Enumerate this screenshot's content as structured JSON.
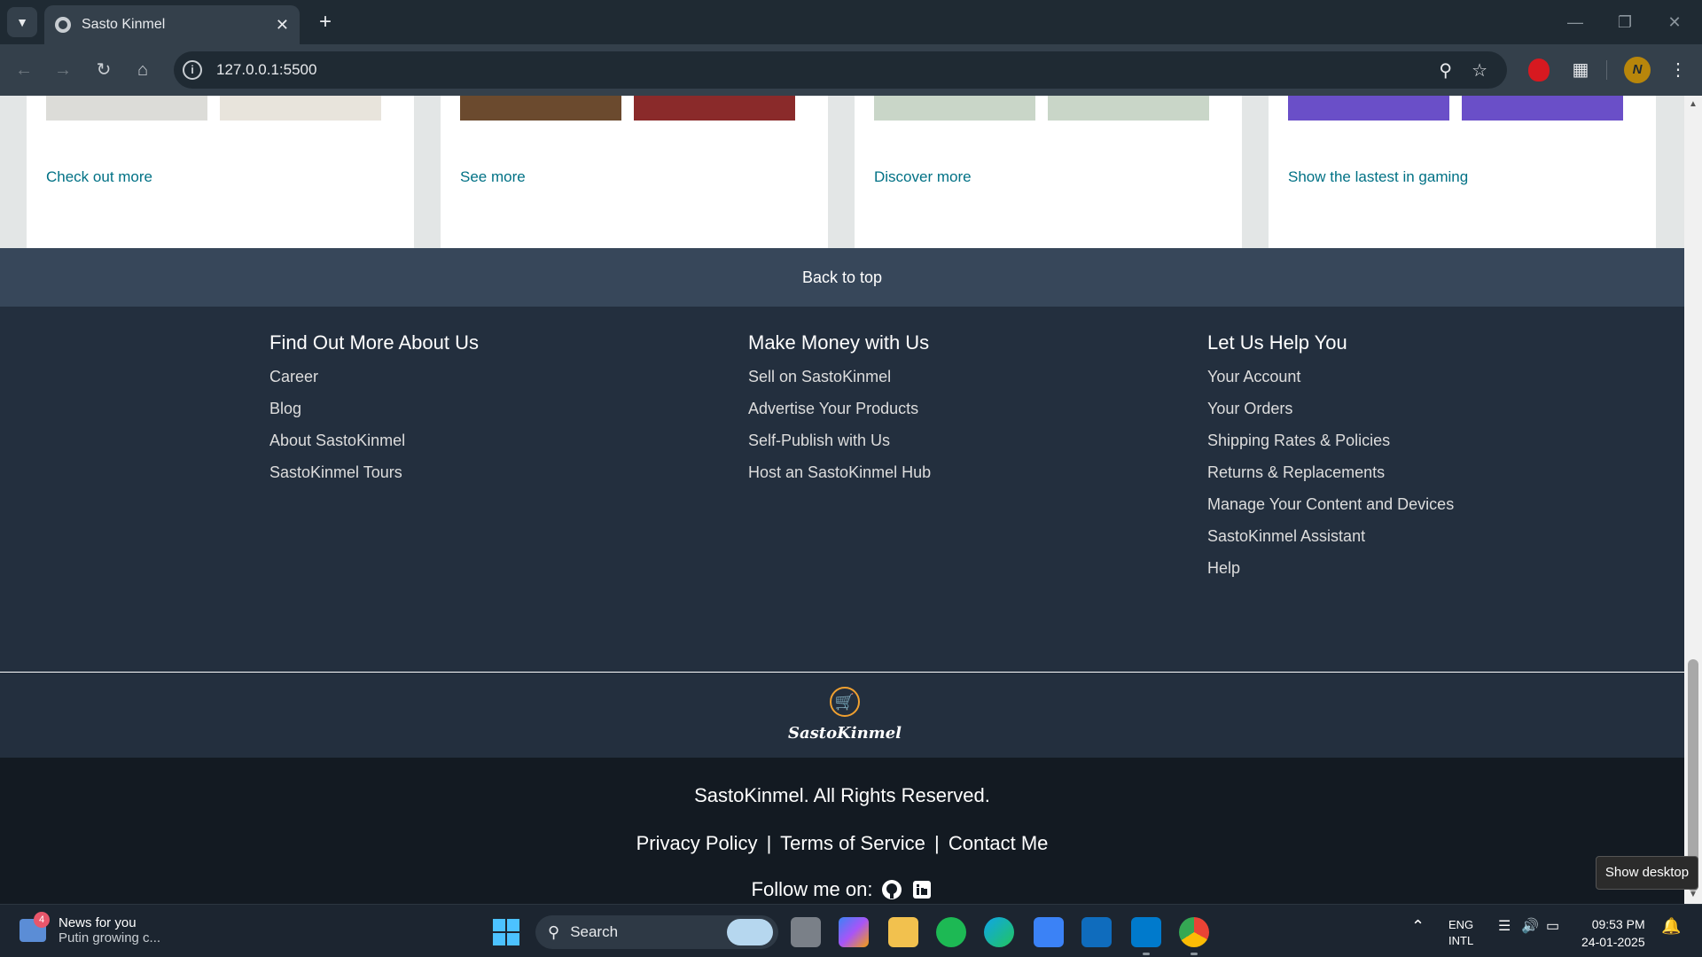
{
  "browser": {
    "tab_title": "Sasto Kinmel",
    "url": "127.0.0.1:5500",
    "profile_initial": "N"
  },
  "cards": [
    {
      "link": "Check out more",
      "img_colors": [
        "#dcdcd8",
        "#e8e4dc"
      ]
    },
    {
      "link": "See more",
      "img_colors": [
        "#6b4a2e",
        "#8a2a2a"
      ]
    },
    {
      "link": "Discover more",
      "img_colors": [
        "#c9d6c8",
        "#c9d6c8"
      ]
    },
    {
      "link": "Show the lastest in gaming",
      "img_colors": [
        "#6a4fc8",
        "#6a4fc8"
      ]
    }
  ],
  "back_to_top": "Back to top",
  "footer": {
    "columns": [
      {
        "title": "Find Out More About Us",
        "links": [
          "Career",
          "Blog",
          "About SastoKinmel",
          "SastoKinmel Tours"
        ]
      },
      {
        "title": "Make Money with Us",
        "links": [
          "Sell on SastoKinmel",
          "Advertise Your Products",
          "Self-Publish with Us",
          "Host an SastoKinmel Hub"
        ]
      },
      {
        "title": "Let Us Help You",
        "links": [
          "Your Account",
          "Your Orders",
          "Shipping Rates & Policies",
          "Returns & Replacements",
          "Manage Your Content and Devices",
          "SastoKinmel Assistant",
          "Help"
        ]
      }
    ],
    "brand_name": "SastoKinmel",
    "rights": "SastoKinmel. All Rights Reserved.",
    "policies": [
      "Privacy Policy",
      "Terms of Service",
      "Contact Me"
    ],
    "separator": "|",
    "follow": "Follow me on:"
  },
  "tooltip": "Show desktop",
  "taskbar": {
    "news_title": "News for you",
    "news_subtitle": "Putin growing c...",
    "news_badge": "4",
    "search_placeholder": "Search",
    "lang": "ENG",
    "layout": "INTL",
    "time": "09:53 PM",
    "date": "24-01-2025"
  },
  "colors": {
    "link": "#007185",
    "footer_bg": "#232f3e",
    "back_to_top_bg": "#37475a",
    "bottom_bg": "#131a22",
    "accent": "#f0a030"
  }
}
